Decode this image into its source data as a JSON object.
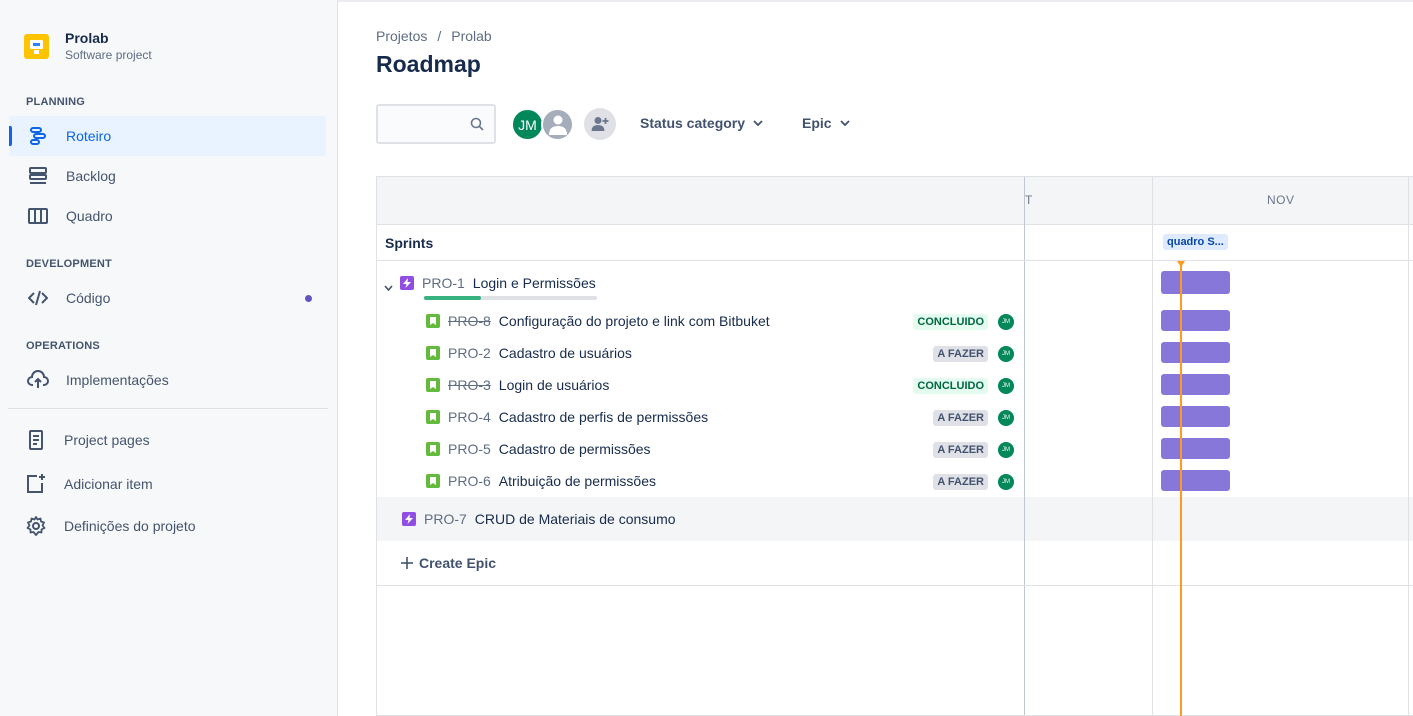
{
  "project": {
    "name": "Prolab",
    "type": "Software project"
  },
  "sidebar": {
    "sections": {
      "planning": "PLANNING",
      "development": "DEVELOPMENT",
      "operations": "OPERATIONS"
    },
    "items": [
      {
        "label": "Roteiro",
        "icon": "roadmap-icon",
        "active": true
      },
      {
        "label": "Backlog",
        "icon": "backlog-icon"
      },
      {
        "label": "Quadro",
        "icon": "board-icon"
      },
      {
        "label": "Código",
        "icon": "code-icon"
      },
      {
        "label": "Implementações",
        "icon": "cloud-upload-icon"
      },
      {
        "label": "Project pages",
        "icon": "page-icon"
      },
      {
        "label": "Adicionar item",
        "icon": "add-item-icon"
      },
      {
        "label": "Definições do projeto",
        "icon": "gear-icon"
      }
    ]
  },
  "breadcrumb": {
    "root": "Projetos",
    "separator": "/",
    "current": "Prolab"
  },
  "page": {
    "title": "Roadmap"
  },
  "toolbar": {
    "search": {
      "placeholder": "",
      "value": ""
    },
    "avatar_initials": "JM",
    "filters": [
      "Status category",
      "Epic"
    ]
  },
  "timeline": {
    "months": [
      "T",
      "NOV"
    ],
    "sprints_label": "Sprints",
    "sprint_chip": "quadro S...",
    "create_epic": "Create Epic"
  },
  "epics": [
    {
      "key": "PRO-1",
      "summary": "Login e Permissões",
      "progress": 0.33,
      "children": [
        {
          "key": "PRO-8",
          "summary": "Configuração do projeto e link com Bitbuket",
          "status": "CONCLUIDO",
          "done": true,
          "assignee": "JM"
        },
        {
          "key": "PRO-2",
          "summary": "Cadastro de usuários",
          "status": "A FAZER",
          "done": false,
          "assignee": "JM"
        },
        {
          "key": "PRO-3",
          "summary": "Login de usuários",
          "status": "CONCLUIDO",
          "done": true,
          "assignee": "JM"
        },
        {
          "key": "PRO-4",
          "summary": "Cadastro de perfis de permissões",
          "status": "A FAZER",
          "done": false,
          "assignee": "JM"
        },
        {
          "key": "PRO-5",
          "summary": "Cadastro de permissões",
          "status": "A FAZER",
          "done": false,
          "assignee": "JM"
        },
        {
          "key": "PRO-6",
          "summary": "Atribuição de permissões",
          "status": "A FAZER",
          "done": false,
          "assignee": "JM"
        }
      ]
    },
    {
      "key": "PRO-7",
      "summary": "CRUD de Materiais de consumo"
    }
  ],
  "colors": {
    "accent": "#0c66e4",
    "epic": "#904ee2",
    "story": "#63ba3c",
    "bar": "#8777d9",
    "today": "#ff991f",
    "done": "#006644"
  }
}
